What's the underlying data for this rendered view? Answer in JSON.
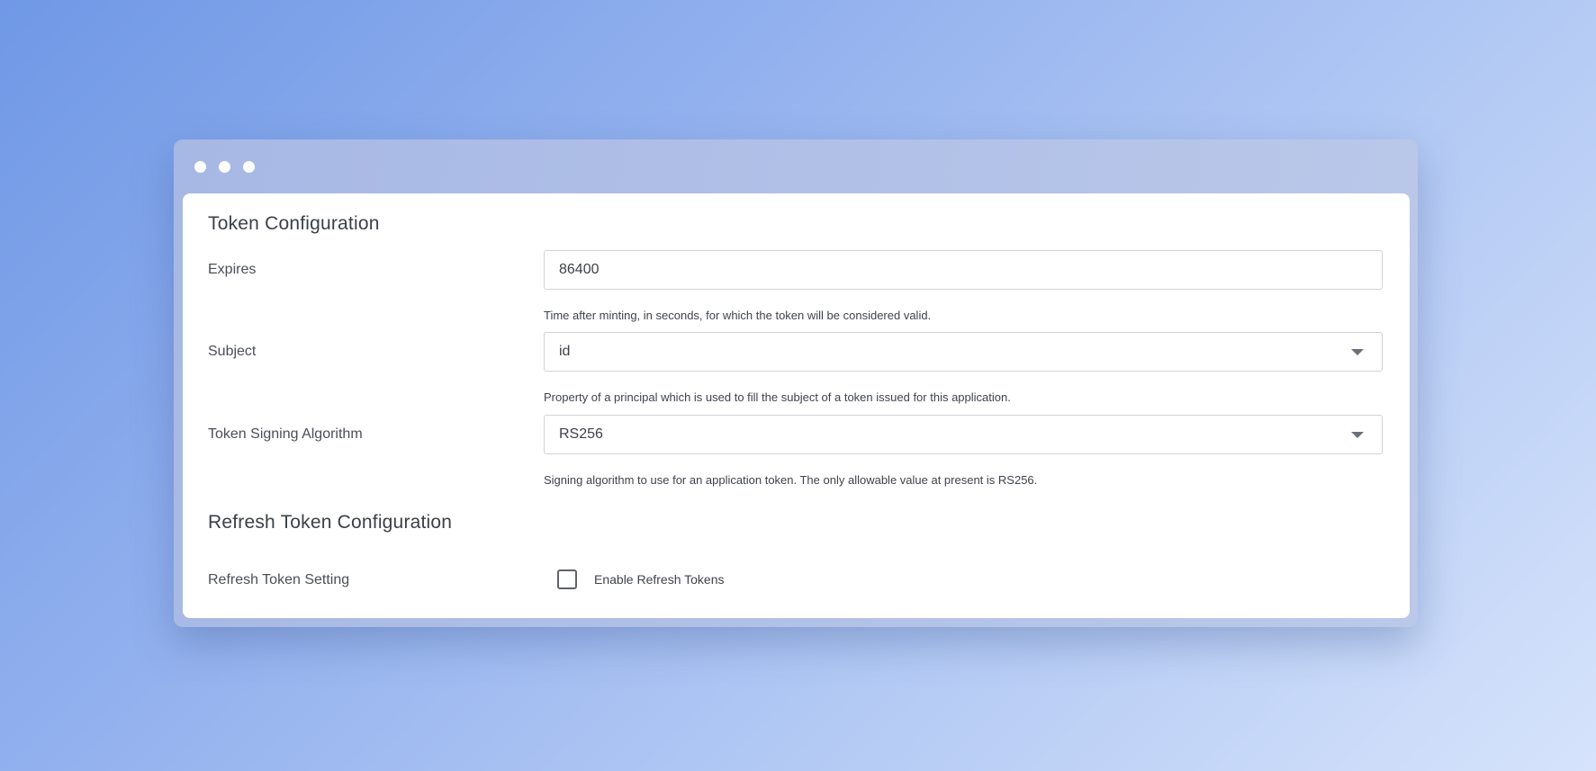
{
  "token_config": {
    "title": "Token Configuration",
    "expires": {
      "label": "Expires",
      "value": "86400",
      "help": "Time after minting, in seconds, for which the token will be considered valid."
    },
    "subject": {
      "label": "Subject",
      "value": "id",
      "help": "Property of a principal which is used to fill the subject of a token issued for this application."
    },
    "signing": {
      "label": "Token Signing Algorithm",
      "value": "RS256",
      "help": "Signing algorithm to use for an application token. The only allowable value at present is RS256."
    }
  },
  "refresh_config": {
    "title": "Refresh Token Configuration",
    "setting_label": "Refresh Token Setting",
    "checkbox_label": "Enable Refresh Tokens",
    "checked": false
  },
  "icons": {
    "dropdown": "chevron-down-icon"
  },
  "colors": {
    "background_start": "#6f98e6",
    "background_end": "#d6e3fb",
    "panel": "#ffffff",
    "text": "#3b3f46"
  }
}
